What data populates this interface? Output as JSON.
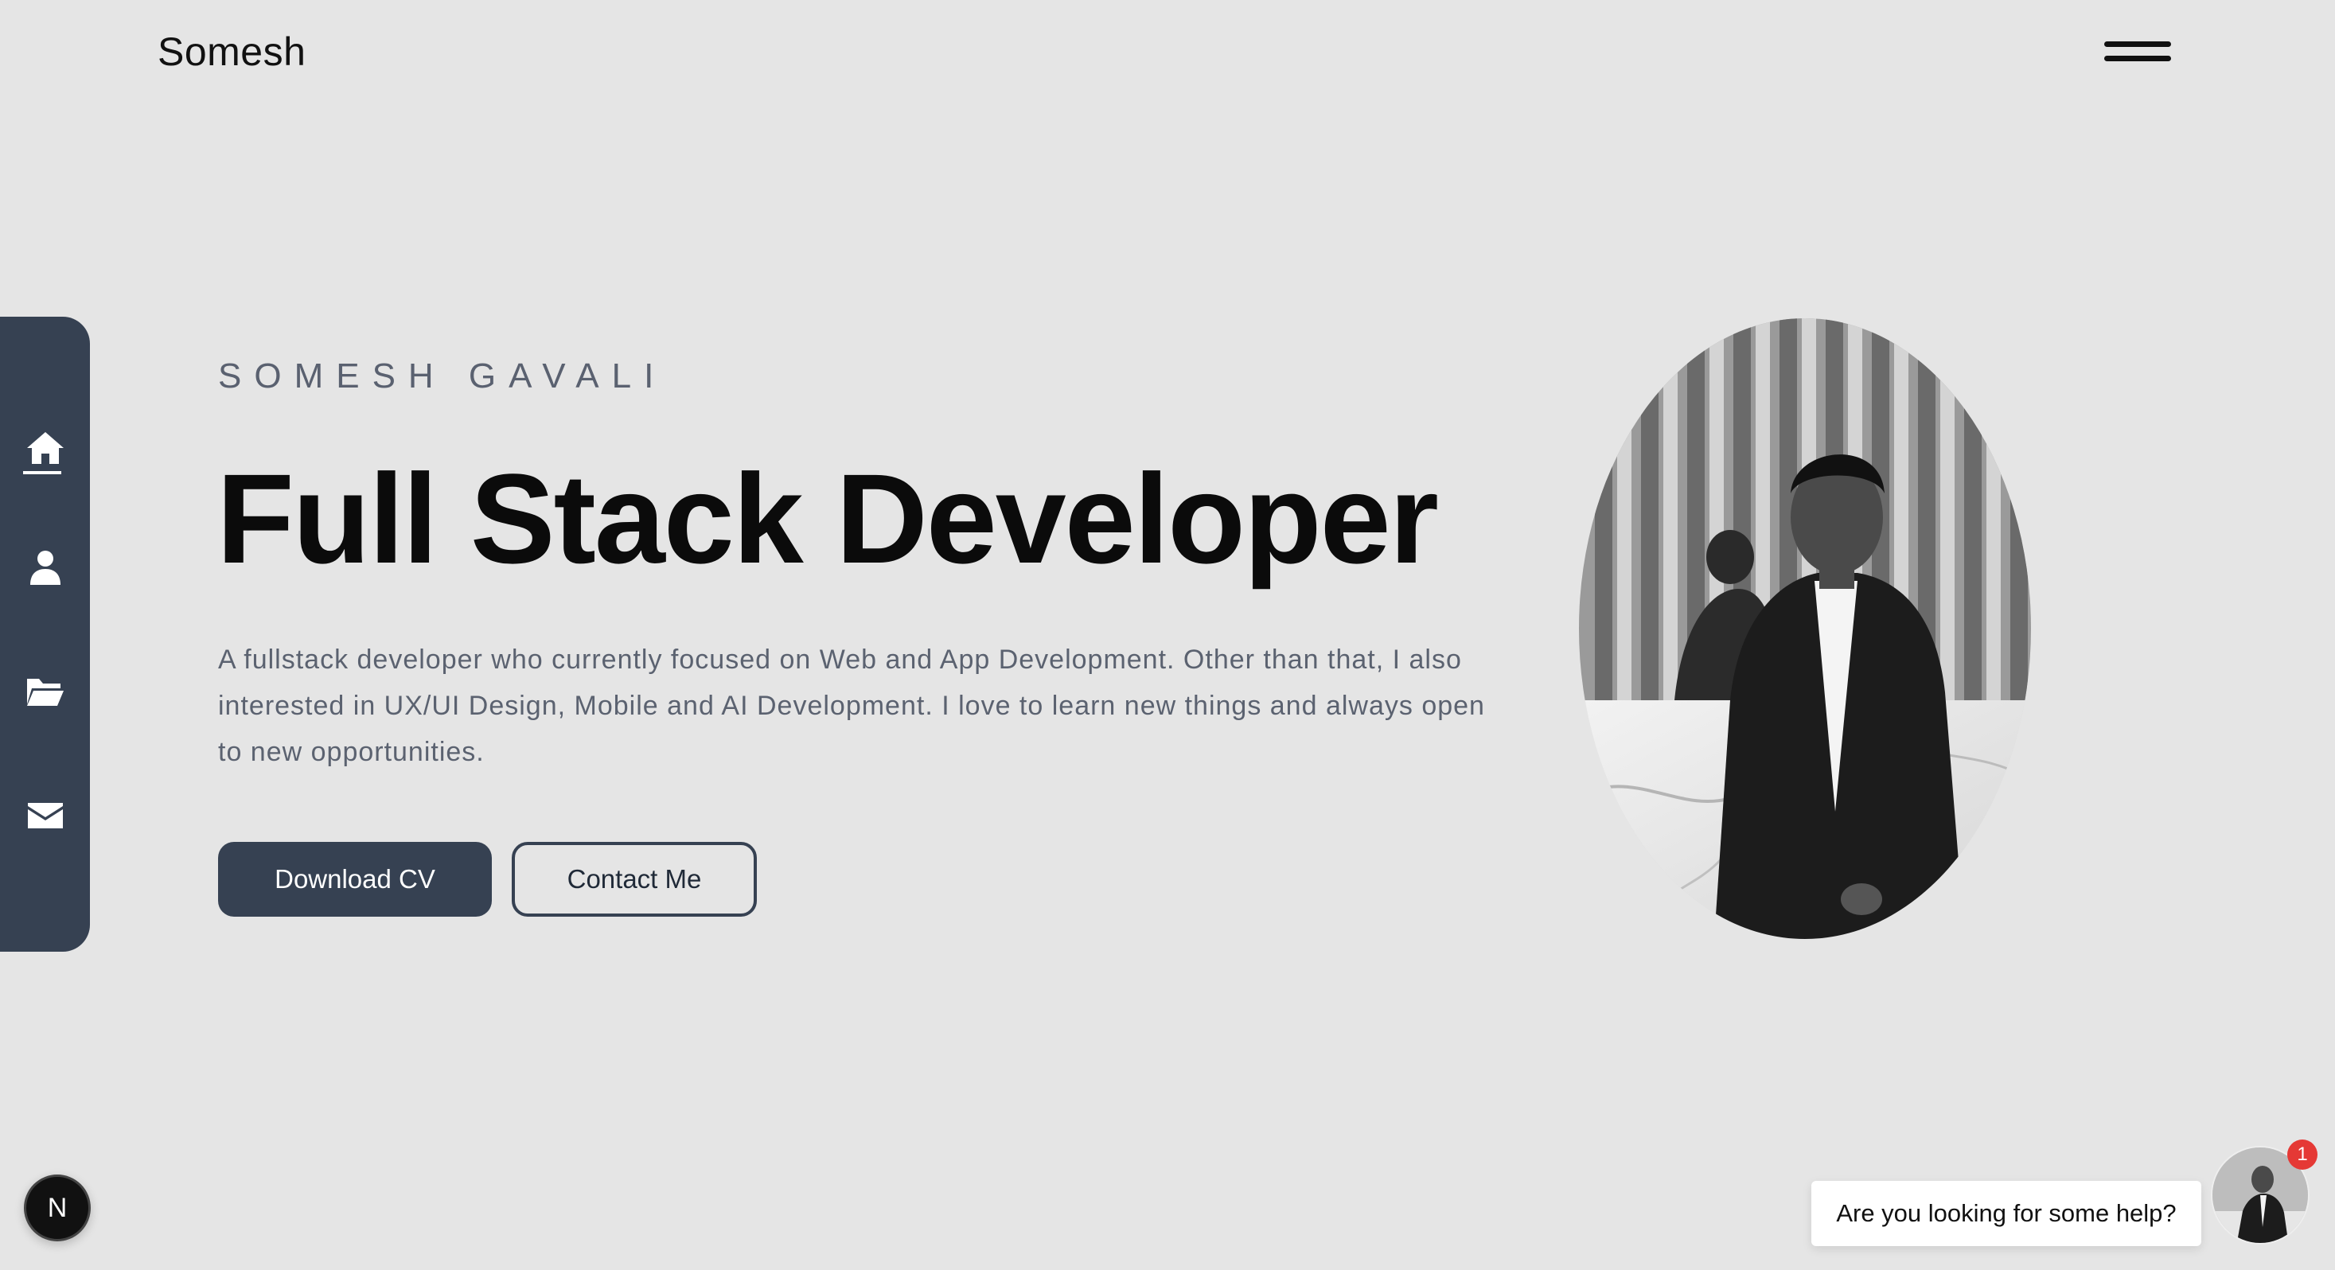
{
  "header": {
    "logo_text": "Somesh",
    "menu_icon": "hamburger-menu-icon"
  },
  "sidebar": {
    "items": [
      {
        "label": "Home",
        "icon": "home-icon",
        "active": true
      },
      {
        "label": "About",
        "icon": "user-icon"
      },
      {
        "label": "Projects",
        "icon": "folder-open-icon"
      },
      {
        "label": "Contact",
        "icon": "envelope-icon"
      }
    ],
    "background_color": "#364152"
  },
  "hero": {
    "eyebrow": "SOMESH GAVALI",
    "headline": "Full Stack Developer",
    "intro": "A fullstack developer who currently focused on Web and App Development. Other than that, I also interested in UX/UI Design, Mobile and AI Development. I love to learn new things and always open to new opportunities.",
    "download_label": "Download CV",
    "contact_label": "Contact Me",
    "portrait_alt": "profile-photo"
  },
  "widgets": {
    "n_badge_label": "N",
    "help_text": "Are you looking for some help?",
    "help_notification_count": "1"
  },
  "colors": {
    "page_background": "#e5e5e5",
    "accent": "#364152",
    "notification": "#e53935"
  }
}
